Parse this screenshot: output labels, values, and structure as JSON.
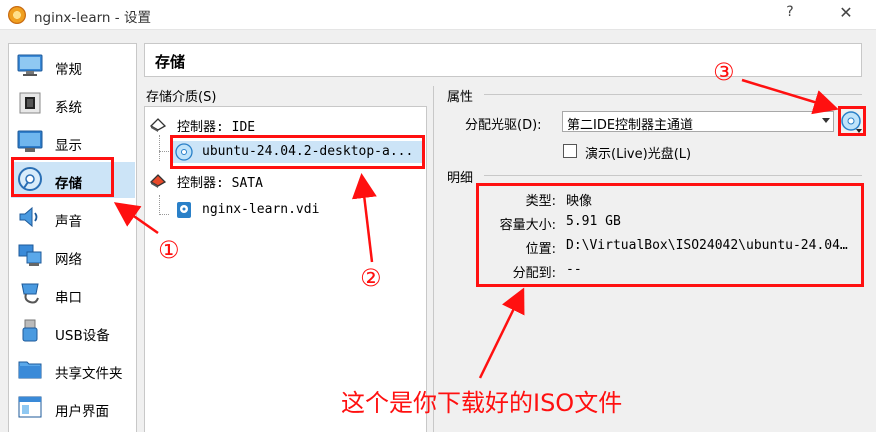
{
  "window": {
    "title": "nginx-learn - 设置",
    "help_label": "?",
    "close_label": "✕"
  },
  "sidebar": {
    "items": [
      {
        "label": "常规",
        "icon": "monitor-icon"
      },
      {
        "label": "系统",
        "icon": "chip-icon"
      },
      {
        "label": "显示",
        "icon": "display-icon"
      },
      {
        "label": "存储",
        "icon": "storage-disc-icon",
        "selected": true
      },
      {
        "label": "声音",
        "icon": "speaker-icon"
      },
      {
        "label": "网络",
        "icon": "network-icon"
      },
      {
        "label": "串口",
        "icon": "serial-port-icon"
      },
      {
        "label": "USB设备",
        "icon": "usb-icon"
      },
      {
        "label": "共享文件夹",
        "icon": "shared-folder-icon"
      },
      {
        "label": "用户界面",
        "icon": "user-interface-icon"
      }
    ]
  },
  "main": {
    "page_title": "存储",
    "media_heading": "存储介质(S)",
    "tree": {
      "controller_ide": "控制器: IDE",
      "ide_disc": "ubuntu-24.04.2-desktop-a...",
      "controller_sata": "控制器: SATA",
      "sata_disk": "nginx-learn.vdi"
    },
    "attributes": {
      "heading": "属性",
      "drive_label": "分配光驱(D):",
      "drive_value": "第二IDE控制器主通道",
      "live_cd_label": "演示(Live)光盘(L)",
      "live_cd_checked": false
    },
    "details": {
      "heading": "明细",
      "rows": [
        {
          "key": "类型:",
          "value": "映像"
        },
        {
          "key": "容量大小:",
          "value": "5.91 GB"
        },
        {
          "key": "位置:",
          "value": "D:\\VirtualBox\\ISO24042\\ubuntu-24.04…"
        },
        {
          "key": "分配到:",
          "value": "--"
        }
      ]
    }
  },
  "annotations": {
    "marker_1": "①",
    "marker_2": "②",
    "marker_3": "③",
    "note": "这个是你下载好的ISO文件",
    "color": "#ff1010"
  },
  "colors": {
    "selection": "#cce4f7",
    "annotation": "#ff1010"
  }
}
